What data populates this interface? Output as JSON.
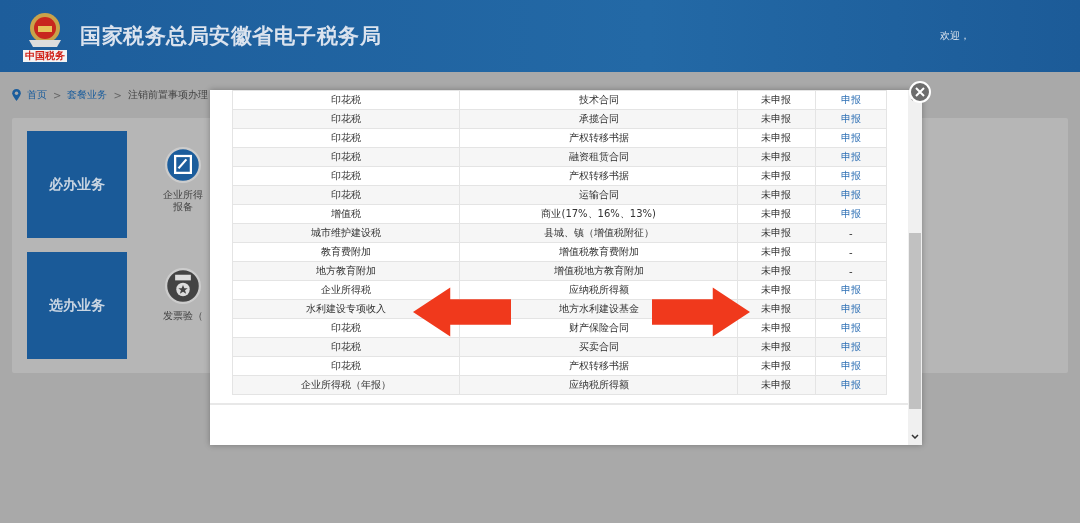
{
  "header": {
    "title": "国家税务总局安徽省电子税务局",
    "logo_caption": "中国税务",
    "welcome": "欢迎，"
  },
  "breadcrumb": [
    {
      "text": "首页",
      "kind": "link"
    },
    {
      "text": ">",
      "kind": "separator"
    },
    {
      "text": "套餐业务",
      "kind": "link"
    },
    {
      "text": ">",
      "kind": "separator"
    },
    {
      "text": "注销前置事项办理",
      "kind": "text"
    }
  ],
  "sections": [
    {
      "label": "必办业务",
      "kind": "edit",
      "item_lines": [
        "企业所得",
        "报备"
      ]
    },
    {
      "label": "选办业务",
      "kind": "medal",
      "item_lines": [
        "发票验（"
      ]
    }
  ],
  "modal": {
    "rows": [
      {
        "tax": "印花税",
        "item": "技术合同",
        "status": "未申报",
        "action": "申报",
        "kind": "link"
      },
      {
        "tax": "印花税",
        "item": "承揽合同",
        "status": "未申报",
        "action": "申报",
        "kind": "link"
      },
      {
        "tax": "印花税",
        "item": "产权转移书据",
        "status": "未申报",
        "action": "申报",
        "kind": "link"
      },
      {
        "tax": "印花税",
        "item": "融资租赁合同",
        "status": "未申报",
        "action": "申报",
        "kind": "link"
      },
      {
        "tax": "印花税",
        "item": "产权转移书据",
        "status": "未申报",
        "action": "申报",
        "kind": "link"
      },
      {
        "tax": "印花税",
        "item": "运输合同",
        "status": "未申报",
        "action": "申报",
        "kind": "link"
      },
      {
        "tax": "增值税",
        "item": "商业(17%、16%、13%)",
        "status": "未申报",
        "action": "申报",
        "kind": "link"
      },
      {
        "tax": "城市维护建设税",
        "item": "县城、镇（增值税附征）",
        "status": "未申报",
        "action": "-",
        "kind": "text"
      },
      {
        "tax": "教育费附加",
        "item": "增值税教育费附加",
        "status": "未申报",
        "action": "-",
        "kind": "text"
      },
      {
        "tax": "地方教育附加",
        "item": "增值税地方教育附加",
        "status": "未申报",
        "action": "-",
        "kind": "text"
      },
      {
        "tax": "企业所得税",
        "item": "应纳税所得额",
        "status": "未申报",
        "action": "申报",
        "kind": "link"
      },
      {
        "tax": "水利建设专项收入",
        "item": "地方水利建设基金",
        "status": "未申报",
        "action": "申报",
        "kind": "link"
      },
      {
        "tax": "印花税",
        "item": "财产保险合同",
        "status": "未申报",
        "action": "申报",
        "kind": "link"
      },
      {
        "tax": "印花税",
        "item": "买卖合同",
        "status": "未申报",
        "action": "申报",
        "kind": "link"
      },
      {
        "tax": "印花税",
        "item": "产权转移书据",
        "status": "未申报",
        "action": "申报",
        "kind": "link"
      },
      {
        "tax": "企业所得税（年报）",
        "item": "应纳税所得额",
        "status": "未申报",
        "action": "申报",
        "kind": "link"
      }
    ]
  }
}
